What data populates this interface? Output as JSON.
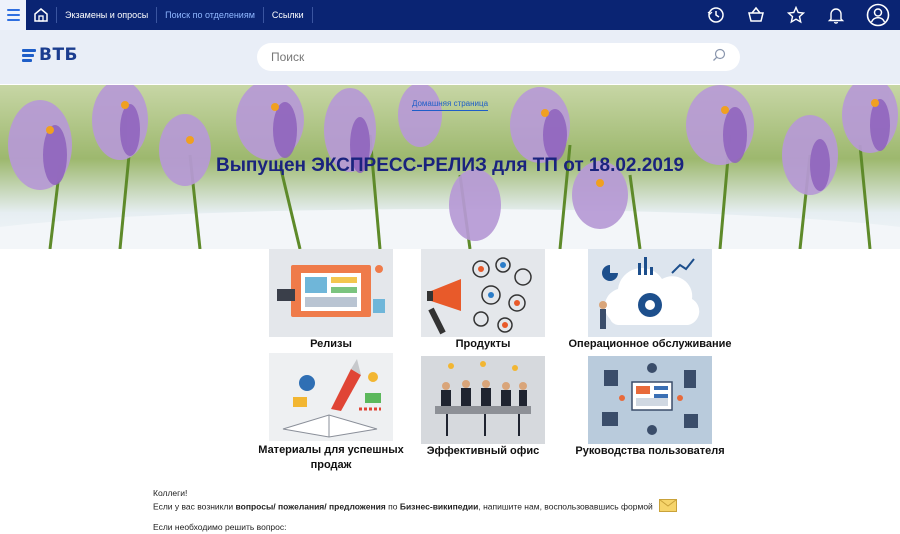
{
  "topnav": {
    "links": [
      "Экзамены и опросы",
      "Поиск по отделениям",
      "Ссылки"
    ],
    "active_index": 1,
    "icons": [
      "history-icon",
      "basket-icon",
      "star-icon",
      "bell-icon",
      "user-icon"
    ]
  },
  "header": {
    "logo_text": "ВТБ",
    "search_placeholder": "Поиск"
  },
  "banner": {
    "breadcrumb": "Домашняя страница",
    "headline": "Выпущен ЭКСПРЕСС-РЕЛИЗ для ТП от 18.02.2019"
  },
  "tiles": [
    {
      "label": "Релизы"
    },
    {
      "label": "Продукты"
    },
    {
      "label": "Операционное обслуживание"
    },
    {
      "label": "Материалы для успешных продаж"
    },
    {
      "label": "Эффективный офис"
    },
    {
      "label": "Руководства пользователя"
    }
  ],
  "footer": {
    "greeting": "Коллеги!",
    "line1_prefix": "Если у вас возникли ",
    "line1_bold": "вопросы/ пожелания/ предложения",
    "line1_mid": " по ",
    "line1_bold2": "Бизнес-википедии",
    "line1_suffix": ", напишите нам, воспользовавшись формой",
    "line2": "Если необходимо решить вопрос:"
  },
  "colors": {
    "nav_bg": "#0a2473",
    "accent": "#1e5ec8",
    "headline": "#1a237e"
  }
}
